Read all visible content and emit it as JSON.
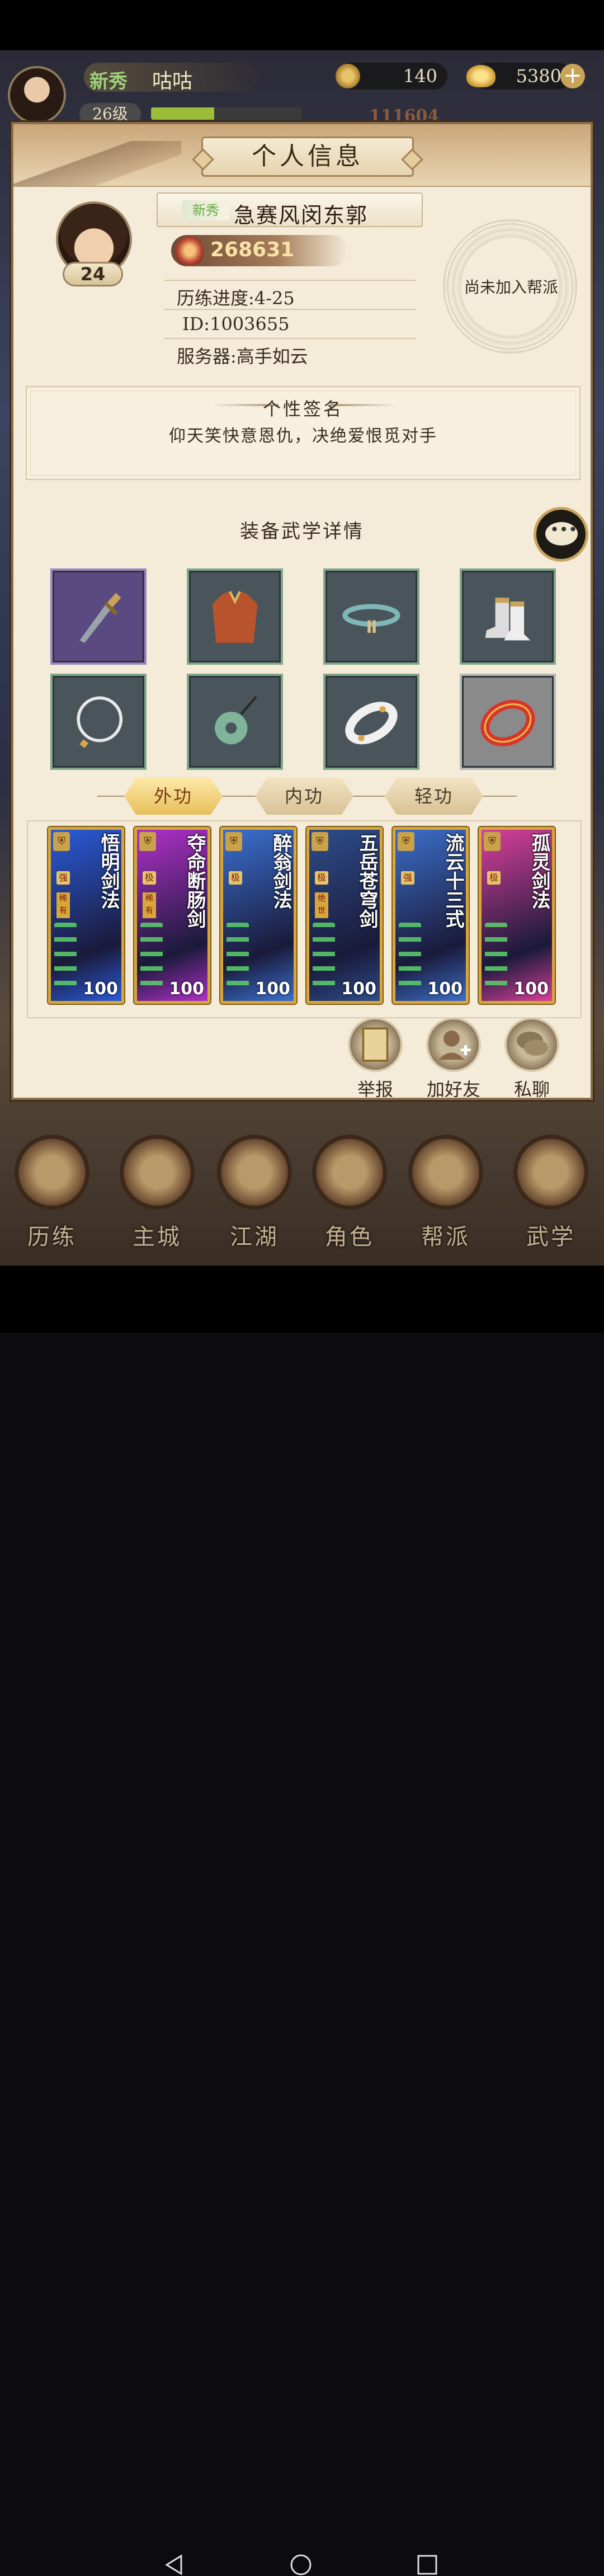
{
  "hud": {
    "rank_badge": "新秀",
    "player_name": "咕咕",
    "level": "26级",
    "exp_fraction": 0.42,
    "coins": "140",
    "gold": "5380",
    "power": "111604",
    "plus_icon": "plus-icon"
  },
  "panel": {
    "title": "个人信息",
    "level": "24",
    "rank_badge": "新秀",
    "name": "急赛风闵东郭",
    "power": "268631",
    "progress": "历练进度:4-25",
    "id": "ID:1003655",
    "server": "服务器:高手如云",
    "guild": "尚未加入帮派"
  },
  "signature": {
    "title": "个性签名",
    "text": "仰天笑快意恩仇，决绝爱恨觅对手"
  },
  "equipment": {
    "title": "装备武学详情",
    "slots": [
      {
        "icon": "dagger-icon",
        "rarity": "purple"
      },
      {
        "icon": "armor-vest-icon",
        "rarity": "green"
      },
      {
        "icon": "belt-icon",
        "rarity": "green"
      },
      {
        "icon": "boots-icon",
        "rarity": "green"
      },
      {
        "icon": "necklace-icon",
        "rarity": "green"
      },
      {
        "icon": "jade-pendant-icon",
        "rarity": "green"
      },
      {
        "icon": "bracelet-icon",
        "rarity": "green"
      },
      {
        "icon": "red-ring-icon",
        "rarity": "gray"
      }
    ]
  },
  "tabs": [
    "外功",
    "内功",
    "轻功"
  ],
  "skills": [
    {
      "name": "悟明剑法",
      "grade": "强",
      "tag": "稀有",
      "level": "100",
      "color": "#2a5bd8"
    },
    {
      "name": "夺命断肠剑",
      "grade": "极",
      "tag": "稀有",
      "level": "100",
      "color": "#b030c8"
    },
    {
      "name": "醉翁剑法",
      "grade": "极",
      "tag": "",
      "level": "100",
      "color": "#3a70d0"
    },
    {
      "name": "五岳苍穹剑",
      "grade": "极",
      "tag": "绝世",
      "level": "100",
      "color": "#2e4c8a"
    },
    {
      "name": "流云十三式",
      "grade": "强",
      "tag": "",
      "level": "100",
      "color": "#3c6ec8"
    },
    {
      "name": "孤灵剑法",
      "grade": "极",
      "tag": "",
      "level": "100",
      "color": "#d8409a"
    }
  ],
  "actions": [
    {
      "label": "举报",
      "icon": "report-book-icon"
    },
    {
      "label": "加好友",
      "icon": "add-friend-icon"
    },
    {
      "label": "私聊",
      "icon": "private-chat-icon"
    }
  ],
  "nav": [
    "历练",
    "主城",
    "江湖",
    "角色",
    "帮派",
    "武学"
  ],
  "colors": {
    "panel_bg": "#f4ecd9",
    "frame": "#8c6d4a",
    "active_tab": "#e7bf5a",
    "skill_border": "#d9a63a"
  }
}
